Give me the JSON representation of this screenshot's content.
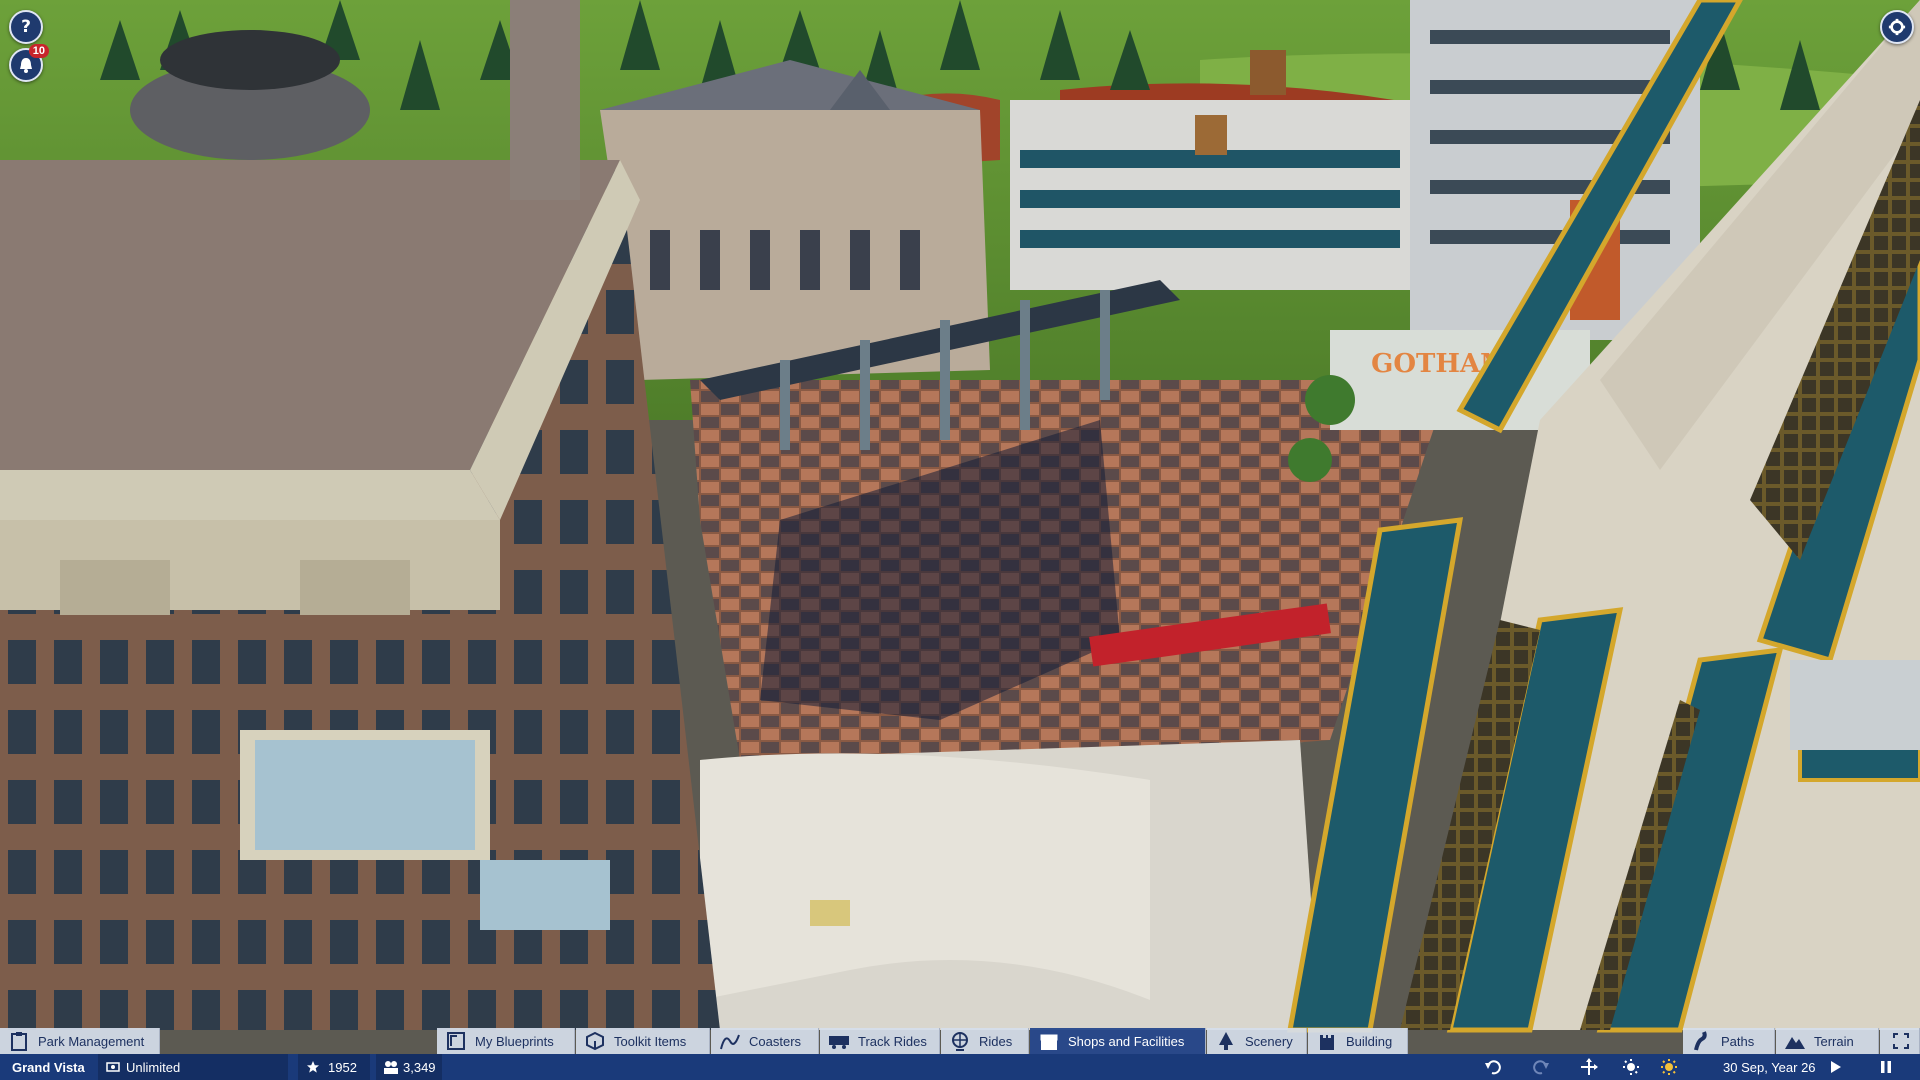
{
  "hud": {
    "help_label": "?",
    "notification_count": "10",
    "settings_icon": "gear-icon"
  },
  "toolbar": {
    "park_management": "Park Management",
    "my_blueprints": "My Blueprints",
    "toolkit_items": "Toolkit Items",
    "coasters": "Coasters",
    "track_rides": "Track Rides",
    "rides": "Rides",
    "shops_facilities": "Shops and Facilities",
    "scenery": "Scenery",
    "building": "Building",
    "paths": "Paths",
    "terrain": "Terrain",
    "active_tab": "Shops and Facilities"
  },
  "status": {
    "park_name": "Grand Vista",
    "money": "Unlimited",
    "rating": "1952",
    "guests": "3,349",
    "date": "30 Sep, Year 26"
  },
  "scene": {
    "sign_text": "GOTHAM"
  },
  "colors": {
    "toolbar_bg": "#d6deec",
    "toolbar_active": "#26488c",
    "statusbar_bg": "#1a3a7a",
    "accent_text": "#1d3160"
  }
}
